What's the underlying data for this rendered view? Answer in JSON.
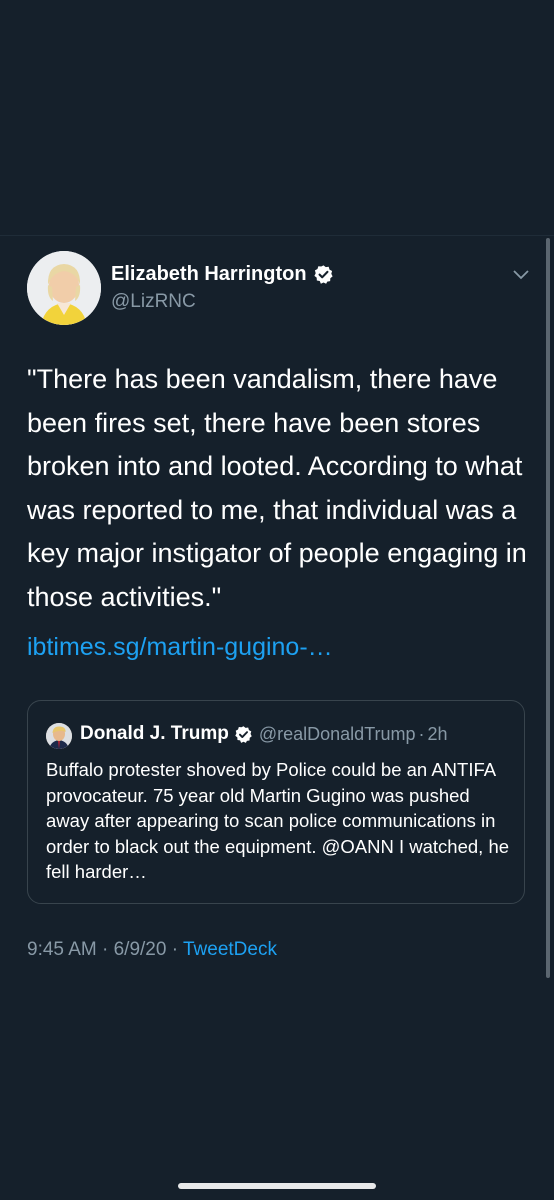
{
  "tweet": {
    "author_name": "Elizabeth Harrington",
    "author_handle": "@LizRNC",
    "text": "\"There has been vandalism, there have been fires set, there have been stores broken into and looted. According to what was reported to me, that individual was a key major instigator of people engaging in those activities.\"",
    "link": "ibtimes.sg/martin-gugino-…",
    "time": "9:45 AM",
    "date": "6/9/20",
    "source": "TweetDeck",
    "separator": " · "
  },
  "quoted_tweet": {
    "author_name": "Donald J. Trump",
    "author_handle": "@realDonaldTrump",
    "age": "2h",
    "separator": "·",
    "text": "Buffalo protester shoved by Police could be an ANTIFA provocateur. 75 year old Martin Gugino was pushed away after appearing to scan police communications in order to black out the equipment. @OANN  I watched, he fell harder…"
  },
  "icons": {
    "verified": "verified-badge-icon",
    "menu": "chevron-down-icon"
  },
  "colors": {
    "background": "#15202b",
    "link": "#1da1f2",
    "secondary_text": "#8899a6",
    "border": "#38444d"
  }
}
